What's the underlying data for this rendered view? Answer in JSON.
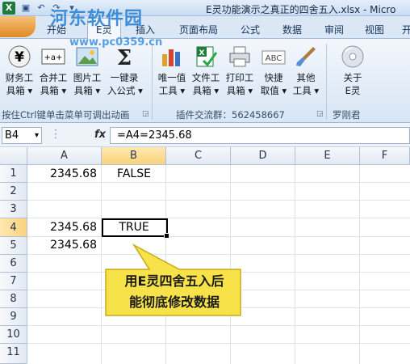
{
  "window": {
    "title": "E灵功能演示之真正的四舍五入.xlsx - Micro",
    "watermark_text": "河东软件园",
    "watermark_url": "www.pc0359.cn"
  },
  "tabs": [
    "开始",
    "E灵",
    "插入",
    "页面布局",
    "公式",
    "数据",
    "审阅",
    "视图",
    "开"
  ],
  "ribbon": {
    "group1_buttons": [
      {
        "line1": "财务工",
        "line2": "具箱 ▾",
        "icon": "yen-icon"
      },
      {
        "line1": "合并工",
        "line2": "具箱 ▾",
        "icon": "merge-icon"
      },
      {
        "line1": "图片工",
        "line2": "具箱 ▾",
        "icon": "picture-icon"
      },
      {
        "line1": "一键录",
        "line2": "入公式 ▾",
        "icon": "sigma-icon"
      }
    ],
    "group1_label": "按住Ctrl键单击菜单可调出动画",
    "group2_buttons": [
      {
        "line1": "唯一值",
        "line2": "工具 ▾",
        "icon": "bar-chart-icon"
      },
      {
        "line1": "文件工",
        "line2": "具箱 ▾",
        "icon": "excel-file-icon"
      },
      {
        "line1": "打印工",
        "line2": "具箱 ▾",
        "icon": "printer-icon"
      },
      {
        "line1": "快捷",
        "line2": "取值 ▾",
        "icon": "abc-icon"
      },
      {
        "line1": "其他",
        "line2": "工具 ▾",
        "icon": "brush-icon"
      }
    ],
    "group2_label": "插件交流群：562458667",
    "group3_buttons": [
      {
        "line1": "关于",
        "line2": "E灵",
        "icon": "cd-icon"
      }
    ],
    "group3_label": "罗刚君"
  },
  "formula_bar": {
    "name_box": "B4",
    "fx_label": "fx",
    "formula": "=A4=2345.68"
  },
  "sheet": {
    "columns": [
      "A",
      "B",
      "C",
      "D",
      "E",
      "F"
    ],
    "rows": [
      "1",
      "2",
      "3",
      "4",
      "5",
      "6",
      "7",
      "8",
      "9",
      "10",
      "11"
    ],
    "cells": {
      "A1": "2345.68",
      "B1": "FALSE",
      "A4": "2345.68",
      "B4": "TRUE",
      "A5": "2345.68"
    },
    "selected_cell": "B4"
  },
  "callout": {
    "line1": "用E灵四舍五入后",
    "line2": "能彻底修改数据",
    "fill": "#f7e24a",
    "stroke": "#c9a81c"
  }
}
